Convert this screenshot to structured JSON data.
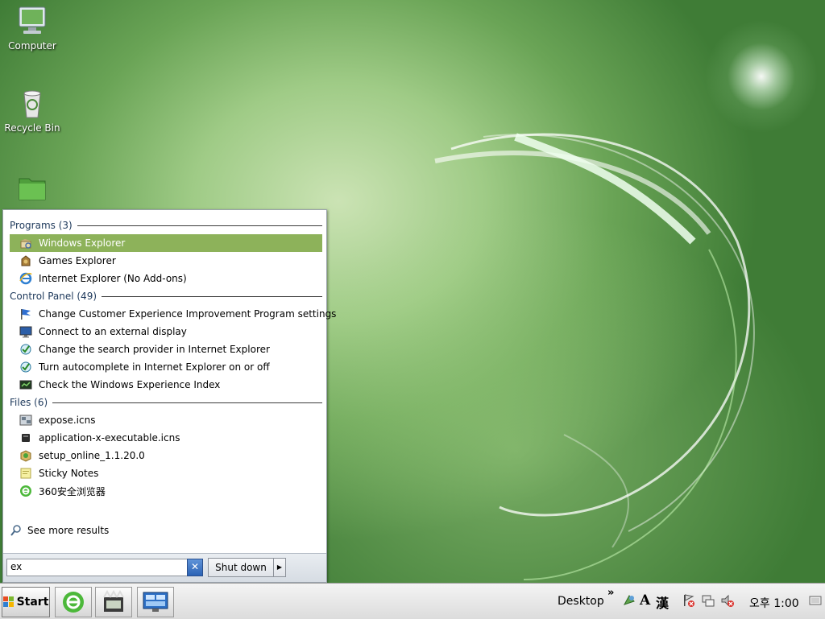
{
  "desktop": {
    "icons": [
      {
        "label": "Computer",
        "icon": "computer-icon"
      },
      {
        "label": "Recycle Bin",
        "icon": "recycle-bin-icon"
      },
      {
        "label": "",
        "icon": "folder-icon"
      }
    ]
  },
  "start_menu": {
    "groups": [
      {
        "header": "Programs (3)",
        "items": [
          {
            "label": "Windows Explorer",
            "icon": "windows-explorer-icon",
            "selected": true
          },
          {
            "label": "Games Explorer",
            "icon": "games-explorer-icon"
          },
          {
            "label": "Internet Explorer (No Add-ons)",
            "icon": "internet-explorer-icon"
          }
        ]
      },
      {
        "header": "Control Panel (49)",
        "items": [
          {
            "label": "Change Customer Experience Improvement Program settings",
            "icon": "flag-icon"
          },
          {
            "label": "Connect to an external display",
            "icon": "display-icon"
          },
          {
            "label": "Change the search provider in Internet Explorer",
            "icon": "internet-options-icon"
          },
          {
            "label": "Turn autocomplete in Internet Explorer on or off",
            "icon": "internet-options-icon"
          },
          {
            "label": "Check the Windows Experience Index",
            "icon": "performance-icon"
          }
        ]
      },
      {
        "header": "Files (6)",
        "items": [
          {
            "label": "expose.icns",
            "icon": "icns-file-icon"
          },
          {
            "label": "application-x-executable.icns",
            "icon": "executable-file-icon"
          },
          {
            "label": "setup_online_1.1.20.0",
            "icon": "setup-package-icon"
          },
          {
            "label": "Sticky Notes",
            "icon": "sticky-notes-icon"
          },
          {
            "label": "360安全浏览器",
            "icon": "browser-360-icon"
          }
        ]
      }
    ],
    "see_more": "See more results",
    "search_value": "ex",
    "shutdown_label": "Shut down",
    "clear_symbol": "✕",
    "arrow_symbol": "▶"
  },
  "taskbar": {
    "start_label": "Start",
    "pinned": [
      {
        "icon": "browser-360-icon"
      },
      {
        "icon": "media-center-icon"
      },
      {
        "icon": "remote-desktop-icon"
      }
    ],
    "desktop_label": "Desktop",
    "chevron": "»",
    "ime_a": "A",
    "ime_hanja": "漢",
    "clock": "오후 1:00"
  },
  "colors": {
    "selection": "#8db25a",
    "group_header": "#1e395b"
  }
}
